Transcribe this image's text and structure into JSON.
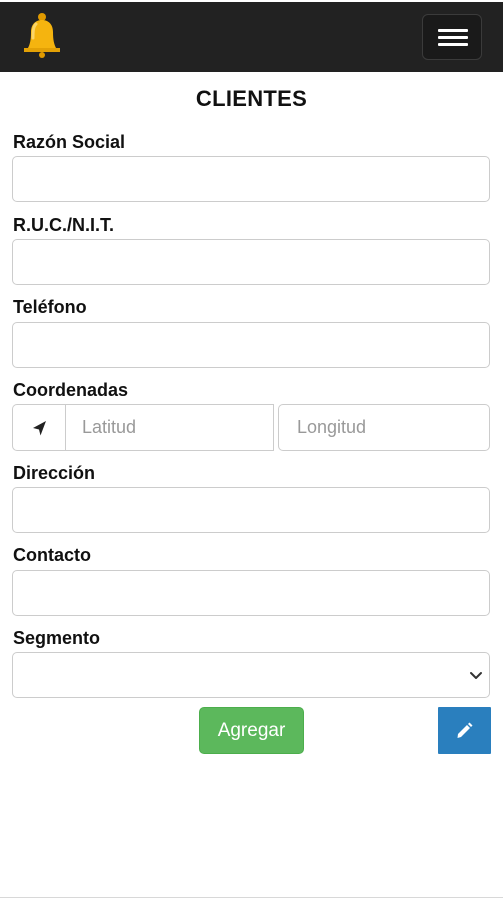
{
  "header": {
    "logo_icon": "bell-icon",
    "menu_icon": "hamburger-menu-icon",
    "background_color": "#222222"
  },
  "page": {
    "title": "CLIENTES"
  },
  "form": {
    "razon_social": {
      "label": "Razón Social",
      "value": ""
    },
    "ruc_nit": {
      "label": "R.U.C./N.I.T.",
      "value": ""
    },
    "telefono": {
      "label": "Teléfono",
      "value": ""
    },
    "coordenadas": {
      "label": "Coordenadas",
      "locate_icon": "location-arrow-icon",
      "latitude_placeholder": "Latitud",
      "longitude_placeholder": "Longitud"
    },
    "direccion": {
      "label": "Dirección",
      "value": ""
    },
    "contacto": {
      "label": "Contacto",
      "value": ""
    },
    "segmento": {
      "label": "Segmento",
      "selected": ""
    }
  },
  "actions": {
    "add_label": "Agregar",
    "add_color": "#5cb85c",
    "edit_icon": "pencil-icon",
    "edit_color": "#2a7fbe"
  }
}
